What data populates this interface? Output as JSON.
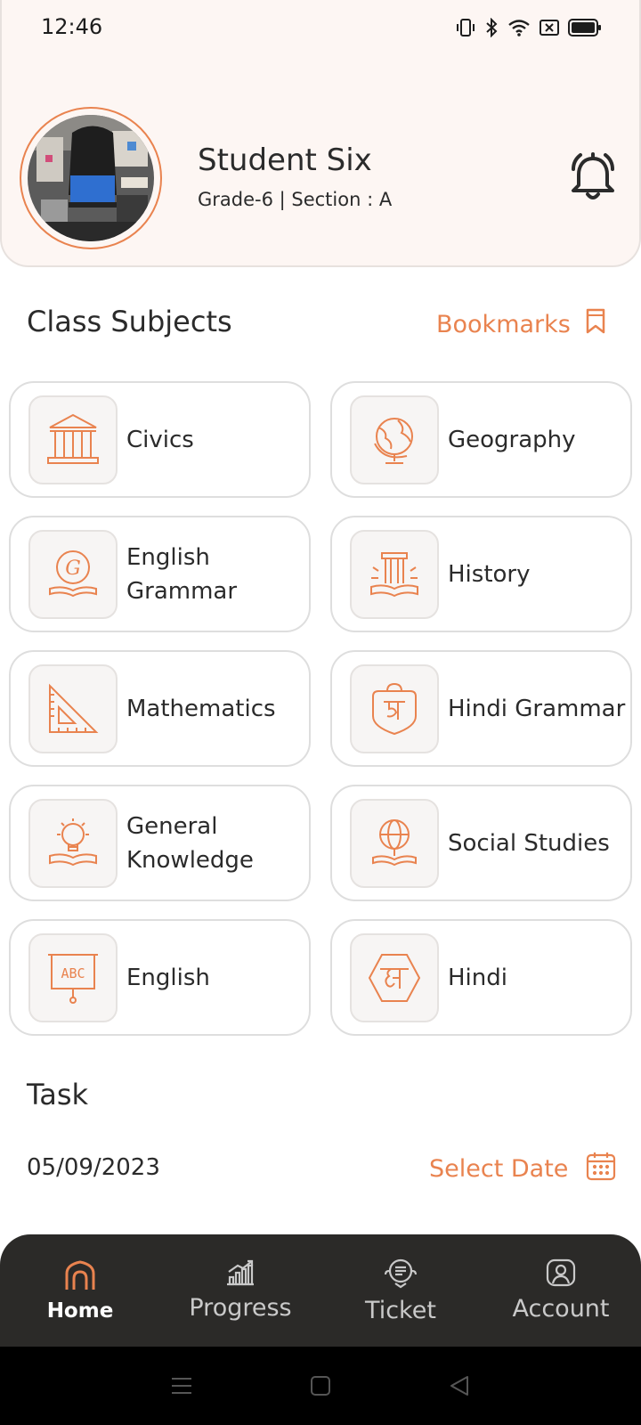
{
  "status_bar": {
    "time": "12:46"
  },
  "profile": {
    "name": "Student Six",
    "meta": "Grade-6 | Section : A"
  },
  "subjects_section": {
    "title": "Class Subjects",
    "bookmarks_label": "Bookmarks"
  },
  "subjects": [
    {
      "label": "Civics",
      "icon": "pillars-icon"
    },
    {
      "label": "Geography",
      "icon": "globe-icon"
    },
    {
      "label": "English\nGrammar",
      "icon": "grammar-book-icon"
    },
    {
      "label": "History",
      "icon": "column-book-icon"
    },
    {
      "label": "Mathematics",
      "icon": "set-square-icon"
    },
    {
      "label": "Hindi Grammar",
      "icon": "hindi-grammar-badge-icon"
    },
    {
      "label": "General\nKnowledge",
      "icon": "lightbulb-book-icon"
    },
    {
      "label": "Social Studies",
      "icon": "globe-book-icon"
    },
    {
      "label": "English",
      "icon": "abc-board-icon"
    },
    {
      "label": "Hindi",
      "icon": "hindi-hexagon-icon"
    }
  ],
  "task_section": {
    "title": "Task",
    "date": "05/09/2023",
    "select_date_label": "Select Date"
  },
  "bottom_nav": [
    {
      "label": "Home",
      "icon": "home-icon",
      "active": true
    },
    {
      "label": "Progress",
      "icon": "progress-chart-icon",
      "active": false
    },
    {
      "label": "Ticket",
      "icon": "ticket-chat-icon",
      "active": false
    },
    {
      "label": "Account",
      "icon": "account-icon",
      "active": false
    }
  ],
  "colors": {
    "accent": "#e9834f",
    "header_bg": "#fdf6f3",
    "nav_bg": "#2b2a28"
  }
}
